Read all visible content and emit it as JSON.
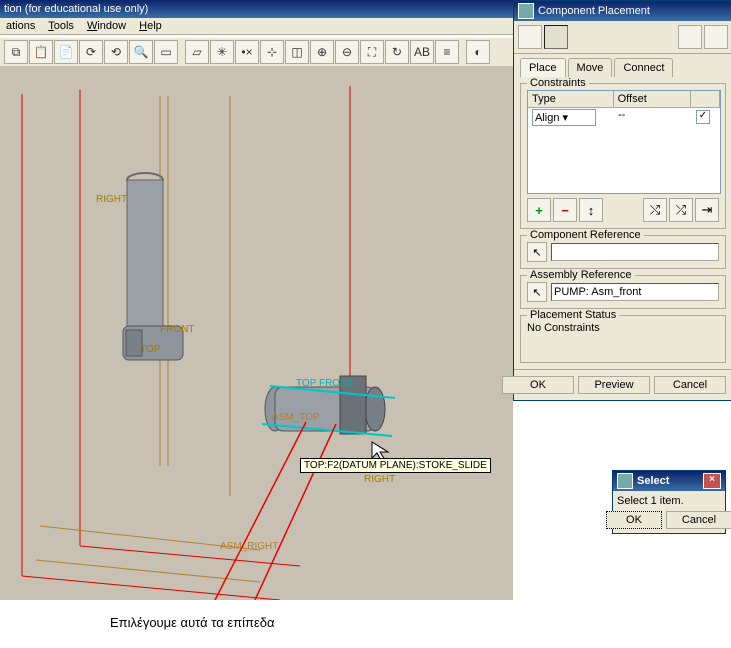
{
  "main_title": "tion (for educational use only)",
  "menus": {
    "m0": "ations",
    "m1": "Tools",
    "m2": "Window",
    "m3": "Help"
  },
  "dialog": {
    "title": "Component Placement",
    "tabs": {
      "t0": "Place",
      "t1": "Move",
      "t2": "Connect"
    },
    "constraints": {
      "legend": "Constraints",
      "h_type": "Type",
      "h_offset": "Offset",
      "row_type": "Align",
      "row_offset": "--"
    },
    "btn_add": "+",
    "btn_del": "−",
    "comp_ref": "Component Reference",
    "asm_ref": "Assembly Reference",
    "asm_val": "PUMP: Asm_front",
    "status_legend": "Placement Status",
    "status_text": "No Constraints",
    "b_ok": "OK",
    "b_prev": "Preview",
    "b_cancel": "Cancel"
  },
  "select": {
    "title": "Select",
    "msg": "Select 1 item.",
    "ok": "OK",
    "cancel": "Cancel"
  },
  "tooltip": "TOP:F2(DATUM PLANE):STOKE_SLIDE",
  "labels": {
    "right": "RIGHT",
    "front": "FRONT",
    "top": "TOP",
    "top_front": "TOP  FRONT",
    "asm_top": "ASM_TOP",
    "asm_right": "ASM_RIGHT",
    "right2": "RIGHT"
  },
  "caption": "Επιλέγουμε αυτά τα επίπεδα"
}
